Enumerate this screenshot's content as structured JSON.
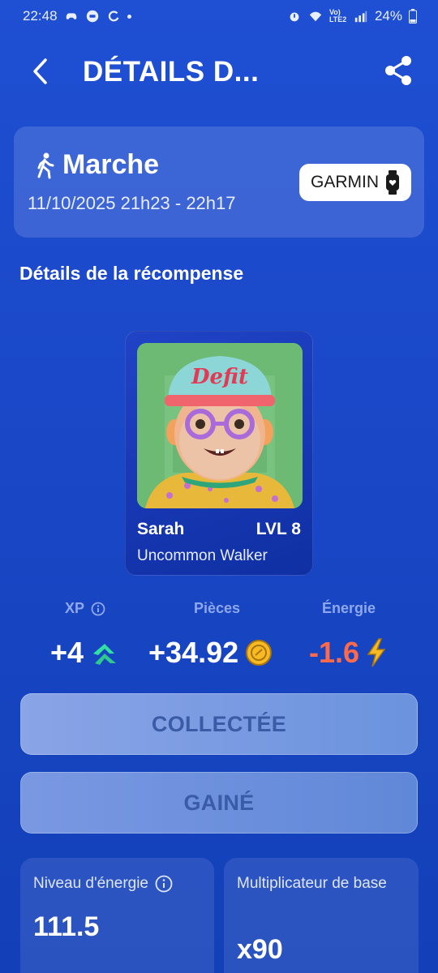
{
  "status_bar": {
    "time": "22:48",
    "network_label": "Vo) LTE2",
    "battery": "24%"
  },
  "header": {
    "title": "DÉTAILS D...",
    "back_icon": "chevron-left-icon",
    "share_icon": "share-icon"
  },
  "activity": {
    "icon": "walking-icon",
    "type": "Marche",
    "date_range": "11/10/2025 21h23 - 22h17",
    "device_label": "GARMIN",
    "device_icon": "smartwatch-icon"
  },
  "reward_section": {
    "title": "Détails de la récompense"
  },
  "character": {
    "portrait_brand": "Defit",
    "name": "Sarah",
    "level": "LVL 8",
    "rarity_class": "Uncommon Walker"
  },
  "stats": {
    "xp_label": "XP",
    "xp_value": "+4",
    "coins_label": "Pièces",
    "coins_value": "+34.92",
    "energy_label": "Énergie",
    "energy_value": "-1.6"
  },
  "buttons": {
    "collect_label": "COLLECTÉE",
    "gain_label": "GAINÉ"
  },
  "info_cards": {
    "energy_level_label": "Niveau d'énergie",
    "energy_level_value": "111.5",
    "multiplier_label": "Multiplicateur de base",
    "multiplier_value": "x90"
  },
  "colors": {
    "background": "#1a48c8",
    "energy_negative": "#ff6b4a",
    "xp_arrow": "#34e0a1",
    "coin": "#f7b924",
    "button_text": "#3a5ba5"
  }
}
